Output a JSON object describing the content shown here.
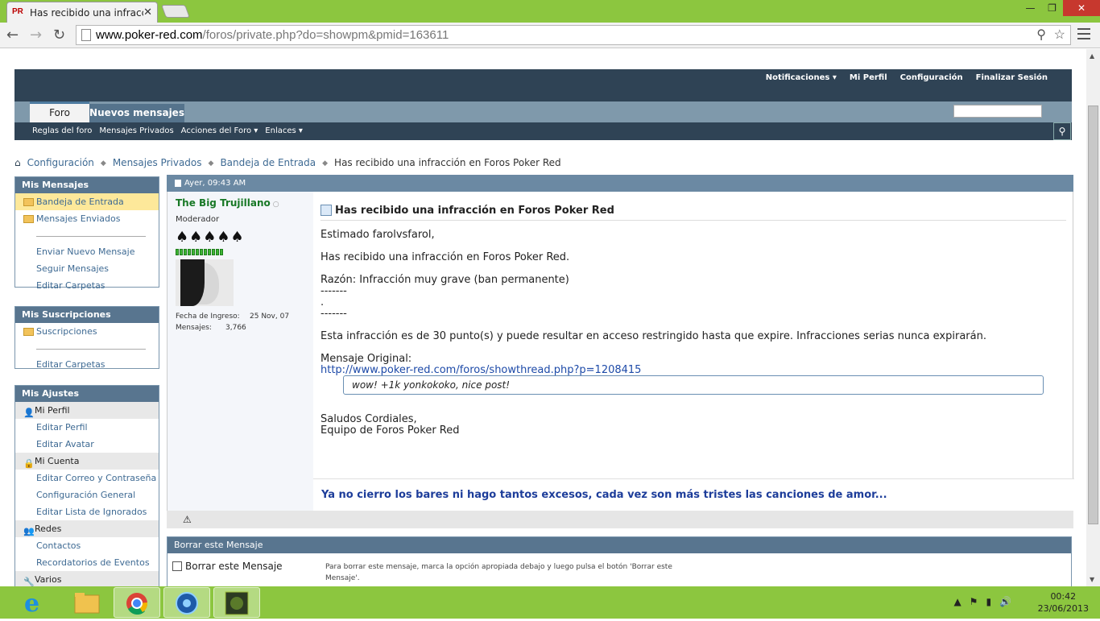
{
  "browser": {
    "tab_title": "Has recibido una infracció",
    "favicon_text": "PR",
    "url_domain": "www.poker-red.com",
    "url_path": "/foros/private.php?do=showpm&pmid=163611"
  },
  "header": {
    "top_links": [
      "Notificaciones ▾",
      "Mi Perfil",
      "Configuración",
      "Finalizar Sesión"
    ],
    "tab_foro": "Foro",
    "tab_nuevos": "Nuevos mensajes",
    "subnav": [
      "Reglas del foro",
      "Mensajes Privados",
      "Acciones del Foro ▾",
      "Enlaces ▾"
    ]
  },
  "breadcrumb": {
    "items": [
      "Configuración",
      "Mensajes Privados",
      "Bandeja de Entrada"
    ],
    "current": "Has recibido una infracción en Foros Poker Red"
  },
  "sidebar": {
    "mis_mensajes": {
      "title": "Mis Mensajes",
      "folders": [
        "Bandeja de Entrada",
        "Mensajes Enviados"
      ],
      "links": [
        "Enviar Nuevo Mensaje",
        "Seguir Mensajes",
        "Editar Carpetas"
      ]
    },
    "mis_suscripciones": {
      "title": "Mis Suscripciones",
      "folders": [
        "Suscripciones"
      ],
      "links": [
        "Editar Carpetas"
      ]
    },
    "mis_ajustes": {
      "title": "Mis Ajustes",
      "groups": [
        {
          "label": "Mi Perfil",
          "links": [
            "Editar Perfil",
            "Editar Avatar"
          ]
        },
        {
          "label": "Mi Cuenta",
          "links": [
            "Editar Correo y Contraseña",
            "Configuración General",
            "Editar Lista de Ignorados"
          ]
        },
        {
          "label": "Redes",
          "links": [
            "Contactos",
            "Recordatorios de Eventos"
          ]
        },
        {
          "label": "Varios",
          "links": []
        }
      ]
    }
  },
  "post": {
    "date": "Ayer, 09:43 AM",
    "user": {
      "name": "The Big Trujillano",
      "role": "Moderador",
      "rank": "♠♠♠♠♠",
      "join_label": "Fecha de Ingreso:",
      "join_value": "25 Nov, 07",
      "posts_label": "Mensajes:",
      "posts_value": "3,766"
    },
    "title": "Has recibido una infracción en Foros Poker Red",
    "body": {
      "greeting": "Estimado farolvsfarol,",
      "line1": "Has recibido una infracción en Foros Poker Red.",
      "reason": "Razón: Infracción muy grave (ban permanente)",
      "dash1": "-------",
      "dot": ".",
      "dash2": "-------",
      "points": "Esta infracción es de 30 punto(s) y puede resultar en acceso restringido hasta que expire. Infracciones serias nunca expirarán.",
      "orig_label": "Mensaje Original:",
      "orig_link": "http://www.poker-red.com/foros/showthread.php?p=1208415",
      "quote": "wow! +1k yonkokoko, nice post!",
      "closing1": "Saludos Cordiales,",
      "closing2": "Equipo de Foros Poker Red"
    },
    "signature": "Ya no cierro los bares ni hago tantos excesos, cada vez son más tristes las canciones de amor..."
  },
  "delete_box": {
    "title": "Borrar este Mensaje",
    "checkbox_label": "Borrar este Mensaje",
    "description": "Para borrar este mensaje, marca la opción apropiada debajo y luego pulsa el botón 'Borrar este Mensaje'."
  },
  "taskbar": {
    "time": "00:42",
    "date": "23/06/2013"
  }
}
